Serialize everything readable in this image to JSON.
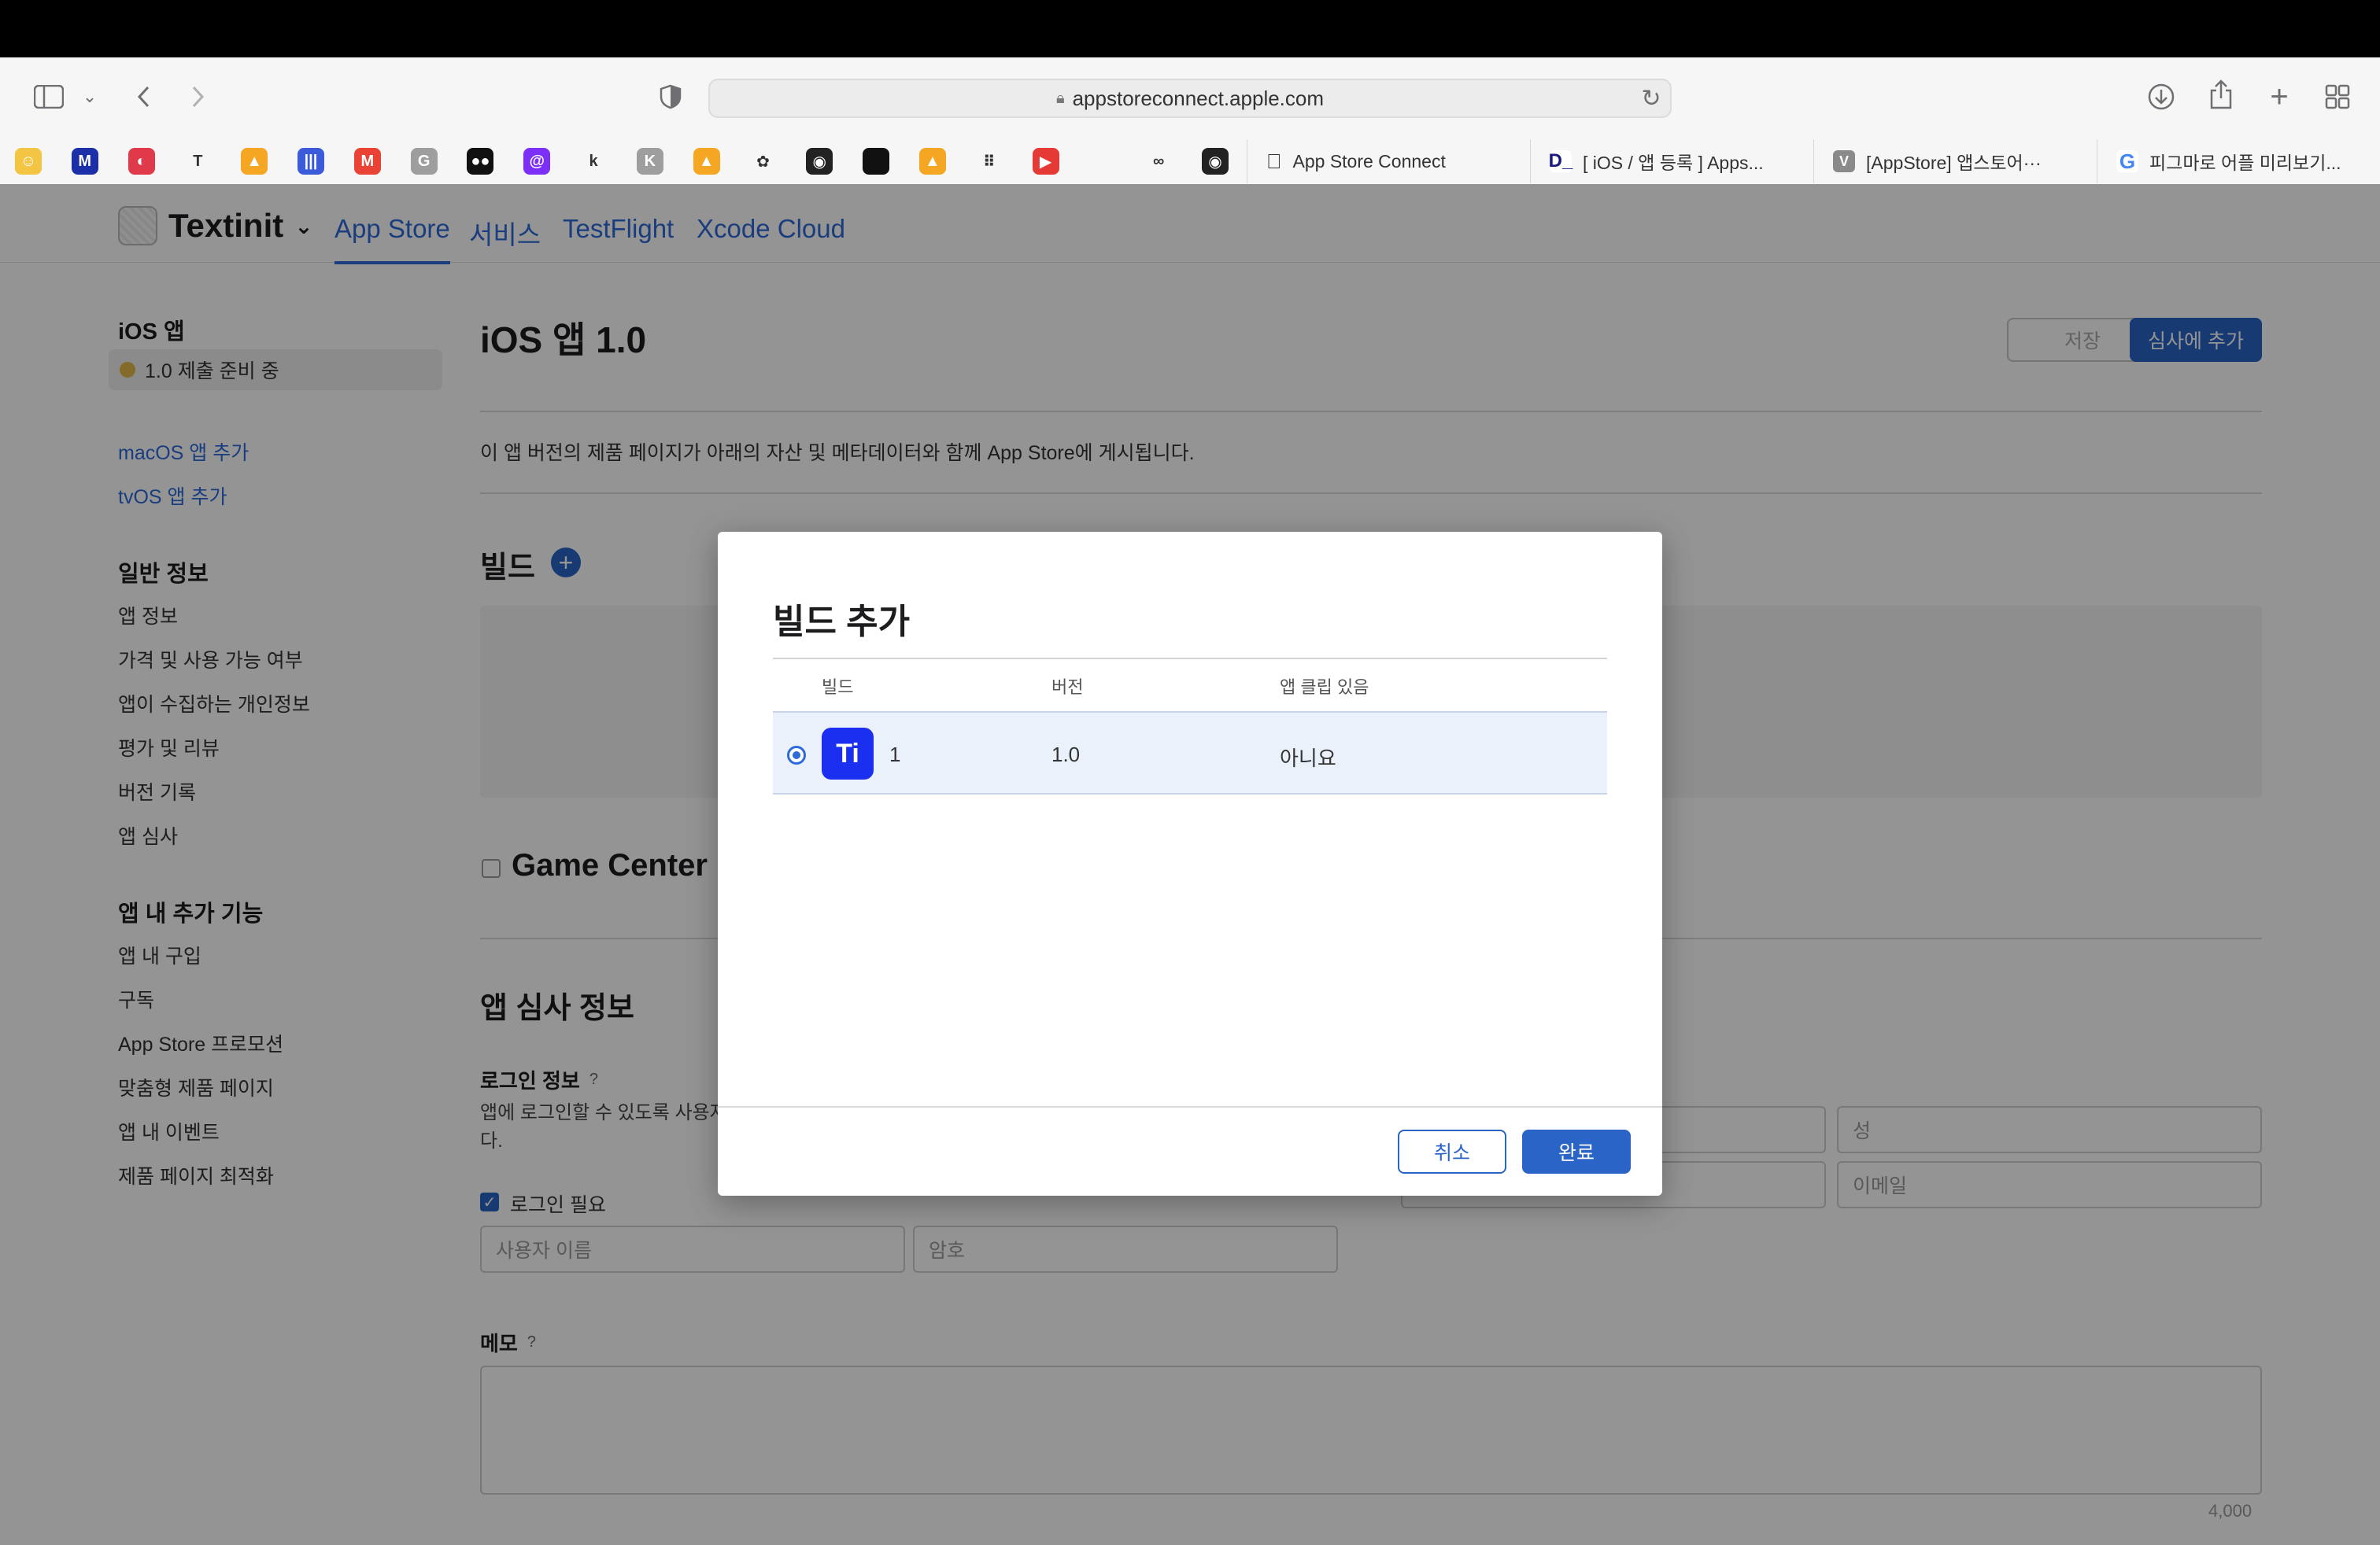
{
  "browser": {
    "url": "appstoreconnect.apple.com",
    "tabs": [
      {
        "title": "App Store Connect",
        "icon": "apple-icon"
      },
      {
        "title": "[ iOS / 앱 등록 ] Apps...",
        "icon": "d-icon"
      },
      {
        "title": "[AppStore] 앱스토어···",
        "icon": "v-icon"
      },
      {
        "title": "피그마로 어플 미리보기...",
        "icon": "google-icon"
      }
    ],
    "bookmarks": [
      "bookmark-1",
      "bookmark-2",
      "bookmark-3",
      "bookmark-4",
      "bookmark-5",
      "bookmark-6",
      "bookmark-7",
      "bookmark-8",
      "bookmark-9",
      "bookmark-10",
      "bookmark-11",
      "bookmark-12",
      "bookmark-13",
      "bookmark-14",
      "bookmark-15",
      "bookmark-16",
      "bookmark-17",
      "bookmark-18",
      "bookmark-19",
      "bookmark-20",
      "bookmark-21",
      "bookmark-22"
    ]
  },
  "header": {
    "app_name": "Textinit",
    "nav": [
      "App Store",
      "서비스",
      "TestFlight",
      "Xcode Cloud"
    ]
  },
  "sidebar": {
    "platform_title": "iOS 앱",
    "version_status": "1.0 제출 준비 중",
    "add_links": [
      "macOS 앱 추가",
      "tvOS 앱 추가"
    ],
    "general_title": "일반 정보",
    "general_items": [
      "앱 정보",
      "가격 및 사용 가능 여부",
      "앱이 수집하는 개인정보",
      "평가 및 리뷰",
      "버전 기록",
      "앱 심사"
    ],
    "features_title": "앱 내 추가 기능",
    "features_items": [
      "앱 내 구입",
      "구독",
      "App Store 프로모션",
      "맞춤형 제품 페이지",
      "앱 내 이벤트",
      "제품 페이지 최적화"
    ]
  },
  "main": {
    "title": "iOS 앱 1.0",
    "save_label": "저장",
    "submit_label": "심사에 추가",
    "description": "이 앱 버전의 제품 페이지가 아래의 자산 및 메타데이터와 함께 App Store에 게시됩니다.",
    "build_title": "빌드",
    "game_center": "Game Center",
    "review_title": "앱 심사 정보",
    "login_title": "로그인 정보",
    "login_desc_1": "앱에 로그인할 수 있도록 사용자",
    "login_desc_2": "다.",
    "login_required": "로그인 필요",
    "username_placeholder": "사용자 이름",
    "password_placeholder": "암호",
    "lastname_placeholder": "성",
    "email_placeholder": "이메일",
    "memo_title": "메모",
    "memo_count": "4,000",
    "help_mark": "?"
  },
  "modal": {
    "title": "빌드 추가",
    "columns": [
      "빌드",
      "버전",
      "앱 클립 있음"
    ],
    "row": {
      "icon_text": "Ti",
      "build": "1",
      "version": "1.0",
      "app_clip": "아니요"
    },
    "cancel_label": "취소",
    "done_label": "완료"
  },
  "colors": {
    "accent": "#2e6ad8",
    "primary_button": "#2a64c6",
    "status_dot": "#e5b84a"
  }
}
